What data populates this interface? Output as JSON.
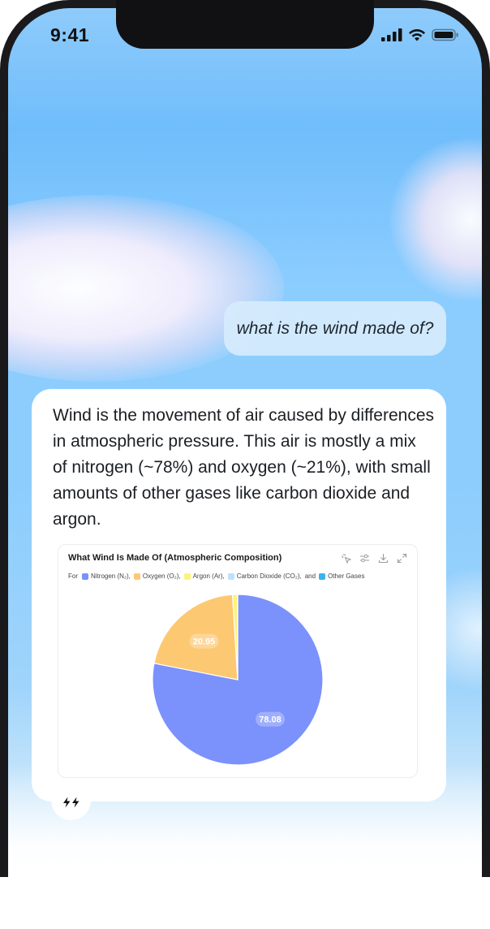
{
  "status": {
    "time": "9:41"
  },
  "conversation": {
    "user_message": "what is the wind made of?",
    "assistant_reply": "Wind is the movement of air caused by differences in atmospheric pressure. This air is mostly a mix of nitrogen (~78%) and oxygen (~21%), with small amounts of other gases like carbon dioxide and argon."
  },
  "chart": {
    "legend_prefix": "For",
    "legend_suffix": "and",
    "tool_icons": [
      "sparkle-pointer-icon",
      "sliders-icon",
      "download-icon",
      "expand-icon"
    ]
  },
  "chart_data": {
    "type": "pie",
    "title": "What Wind Is Made Of (Atmospheric Composition)",
    "categories": [
      "Nitrogen (N₂),",
      "Oxygen (O₂),",
      "Argon (Ar),",
      "Carbon Dioxide (CO₂),",
      "Other Gases"
    ],
    "values": [
      78.08,
      20.95,
      0.93,
      0.04,
      0.002
    ],
    "data_labels": [
      "78.08",
      "20.95"
    ],
    "colors": [
      "#7b91fb",
      "#fdc872",
      "#fdf37a",
      "#bfe0fb",
      "#3ab2ef"
    ],
    "legend_position": "top-left"
  },
  "brand": {
    "mark_icon": "double-bolt-icon"
  }
}
